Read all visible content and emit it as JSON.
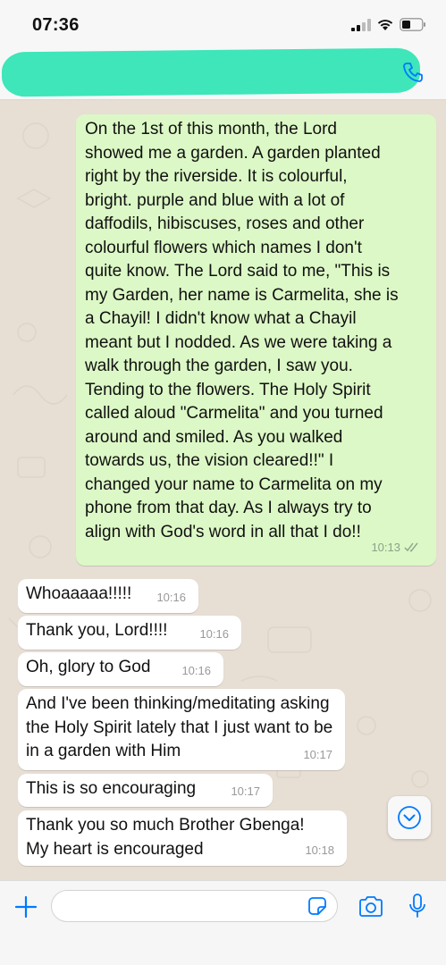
{
  "status_bar": {
    "time": "07:36"
  },
  "header": {
    "contact_name_redacted": true
  },
  "messages": [
    {
      "direction": "outgoing",
      "text": "On the 1st of this month, the Lord\nshowed me a garden. A garden planted\nright by the riverside. It is colourful,\nbright. purple and blue with a lot of\ndaffodils, hibiscuses, roses and other\ncolourful flowers which names I don't\nquite know. The Lord said to me, \"This is\nmy Garden, her name is Carmelita, she is\na Chayil! I didn't know what a Chayil\nmeant but I nodded. As we were taking a\nwalk through the garden, I saw you.\nTending to the flowers. The Holy Spirit\ncalled aloud \"Carmelita\" and you turned\naround and smiled. As you walked\ntowards us, the vision cleared!!\" I\nchanged your name to Carmelita on my\nphone from that day. As I always try to\nalign with God's word in all that I do!!",
      "time": "10:13",
      "status": "read"
    },
    {
      "direction": "incoming",
      "text": "Whoaaaaa!!!!!",
      "time": "10:16"
    },
    {
      "direction": "incoming",
      "text": "Thank you, Lord!!!!",
      "time": "10:16"
    },
    {
      "direction": "incoming",
      "text": "Oh, glory to God",
      "time": "10:16"
    },
    {
      "direction": "incoming",
      "text": "And I've been thinking/meditating asking\nthe Holy Spirit lately that I just want to be\nin a garden with Him",
      "time": "10:17"
    },
    {
      "direction": "incoming",
      "text": "This is so encouraging",
      "time": "10:17"
    },
    {
      "direction": "incoming",
      "text": "Thank you so much Brother Gbenga!\nMy heart is encouraged",
      "time": "10:18"
    }
  ],
  "input": {
    "value": "",
    "placeholder": ""
  },
  "colors": {
    "outgoing_bubble": "#dcf8c6",
    "incoming_bubble": "#ffffff",
    "accent": "#007aff",
    "redaction": "#3ee6b9"
  },
  "icons": [
    "signal-icon",
    "wifi-icon",
    "battery-icon",
    "phone-call-icon",
    "plus-icon",
    "sticker-icon",
    "camera-icon",
    "microphone-icon",
    "chevron-down-icon",
    "double-check-icon"
  ]
}
